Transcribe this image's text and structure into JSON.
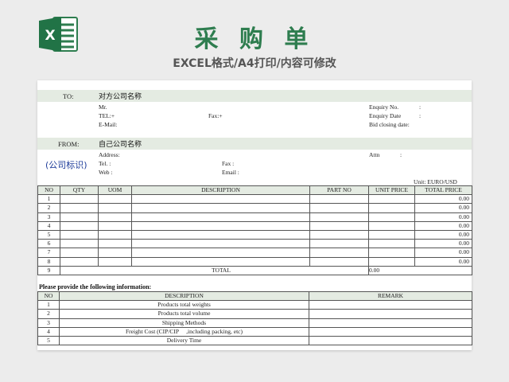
{
  "header": {
    "title": "采 购 单",
    "subtitle": "EXCEL格式/A4打印/内容可修改",
    "logo_icon": "excel-icon",
    "brand_color": "#2e7d4f"
  },
  "to": {
    "label": "TO:",
    "name": "对方公司名称",
    "mr": "Mr.",
    "tel": "TEL:+",
    "fax": "Fax:+",
    "email": "E-Mail:",
    "enquiry_no": "Enquiry No.",
    "enquiry_date": "Enquiry Date",
    "colon": ":",
    "bid_closing": "Bid closing date:"
  },
  "from": {
    "label": "FROM:",
    "name": "自己公司名称",
    "company_logo": "(公司标识)",
    "address": "Address:",
    "attn": "Attn",
    "colon": ":",
    "tel": "Tel. :",
    "fax": "Fax :",
    "web": "Web :",
    "email": "Email :"
  },
  "unit": "Unit: EURO/USD",
  "order_table": {
    "headers": [
      "NO",
      "QTY",
      "UOM",
      "DESCRIPTION",
      "PART NO",
      "UNIT PRICE",
      "TOTAL PRICE"
    ],
    "rows": [
      {
        "no": "1",
        "total": "0.00"
      },
      {
        "no": "2",
        "total": "0.00"
      },
      {
        "no": "3",
        "total": "0.00"
      },
      {
        "no": "4",
        "total": "0.00"
      },
      {
        "no": "5",
        "total": "0.00"
      },
      {
        "no": "6",
        "total": "0.00"
      },
      {
        "no": "7",
        "total": "0.00"
      },
      {
        "no": "8",
        "total": "0.00"
      }
    ],
    "total_row": {
      "no": "9",
      "label": "TOTAL",
      "value": "0.00"
    }
  },
  "info": {
    "note": "Please provide the following information:",
    "headers": [
      "NO",
      "DESCRIPTION",
      "REMARK"
    ],
    "rows": [
      {
        "no": "1",
        "desc": "Products total weights"
      },
      {
        "no": "2",
        "desc": "Products total volume"
      },
      {
        "no": "3",
        "desc": "Shipping Methods"
      },
      {
        "no": "4",
        "desc": "Freight Cost (CIP/CIP     ,including packing, etc)"
      },
      {
        "no": "5",
        "desc": "Delivery Time"
      }
    ]
  }
}
